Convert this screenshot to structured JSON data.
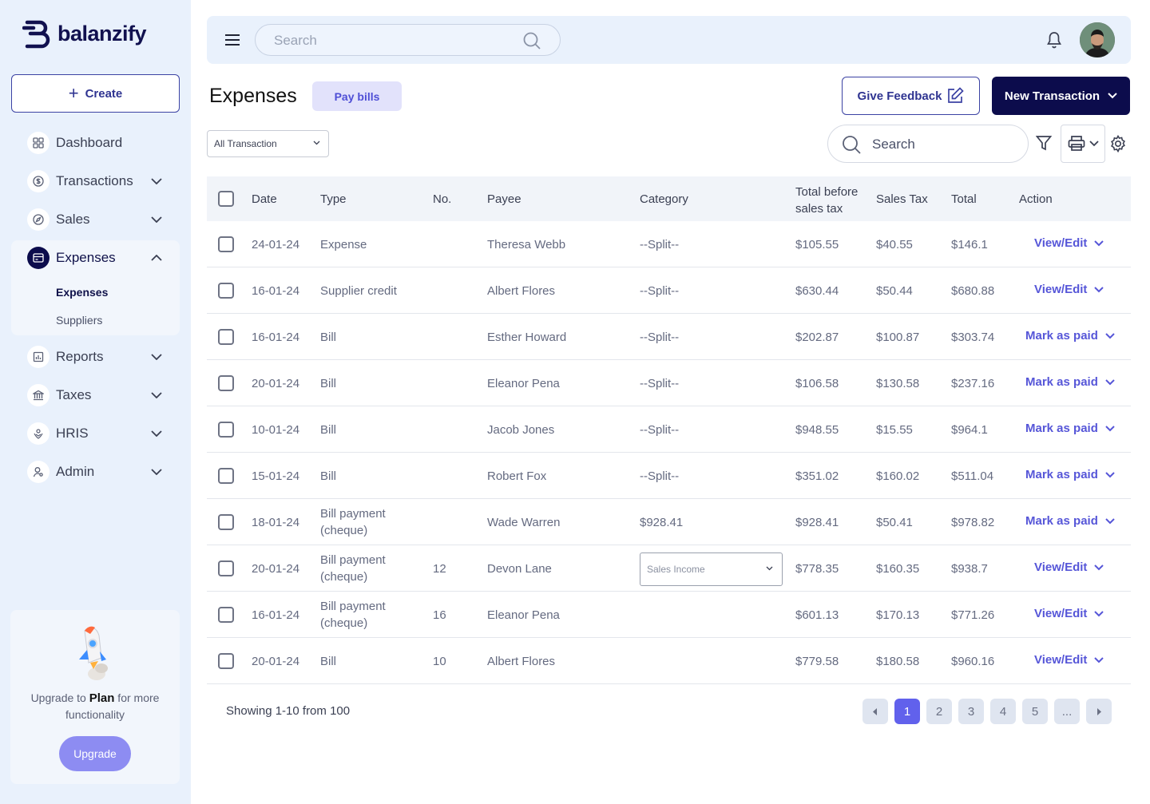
{
  "brand": {
    "name": "balanzify"
  },
  "sidebar": {
    "create_label": "Create",
    "items": [
      {
        "label": "Dashboard",
        "icon": "grid-icon"
      },
      {
        "label": "Transactions",
        "icon": "dollar-coin-icon"
      },
      {
        "label": "Sales",
        "icon": "compass-icon"
      },
      {
        "label": "Expenses",
        "icon": "card-icon"
      },
      {
        "label": "Reports",
        "icon": "chart-icon"
      },
      {
        "label": "Taxes",
        "icon": "bank-icon"
      },
      {
        "label": "HRIS",
        "icon": "hands-icon"
      },
      {
        "label": "Admin",
        "icon": "user-icon"
      }
    ],
    "expenses_sub": [
      "Expenses",
      "Suppliers"
    ],
    "upgrade": {
      "prefix": "Upgrade to ",
      "plan": "Plan",
      "suffix": " for more functionality",
      "button": "Upgrade"
    }
  },
  "topbar": {
    "search_placeholder": "Search"
  },
  "header": {
    "title": "Expenses",
    "pay_bills": "Pay bills",
    "feedback": "Give Feedback",
    "new_transaction": "New Transaction"
  },
  "filters": {
    "transaction_filter": "All Transaction",
    "search_label": "Search"
  },
  "table": {
    "headers": {
      "date": "Date",
      "type": "Type",
      "no": "No.",
      "payee": "Payee",
      "category": "Category",
      "before_tax_1": "Total before",
      "before_tax_2": "sales tax",
      "sales_tax": "Sales Tax",
      "total": "Total",
      "action": "Action"
    },
    "rows": [
      {
        "date": "24-01-24",
        "type": "Expense",
        "type2": "",
        "no": "",
        "payee": "Theresa Webb",
        "category": "--Split--",
        "before": "$105.55",
        "tax": "$40.55",
        "total": "$146.1",
        "action": "View/Edit"
      },
      {
        "date": "16-01-24",
        "type": "Supplier credit",
        "type2": "",
        "no": "",
        "payee": "Albert Flores",
        "category": "--Split--",
        "before": "$630.44",
        "tax": "$50.44",
        "total": "$680.88",
        "action": "View/Edit"
      },
      {
        "date": "16-01-24",
        "type": "Bill",
        "type2": "",
        "no": "",
        "payee": "Esther Howard",
        "category": "--Split--",
        "before": "$202.87",
        "tax": "$100.87",
        "total": "$303.74",
        "action": "Mark as paid"
      },
      {
        "date": "20-01-24",
        "type": "Bill",
        "type2": "",
        "no": "",
        "payee": "Eleanor Pena",
        "category": "--Split--",
        "before": "$106.58",
        "tax": "$130.58",
        "total": "$237.16",
        "action": "Mark as paid"
      },
      {
        "date": "10-01-24",
        "type": "Bill",
        "type2": "",
        "no": "",
        "payee": "Jacob Jones",
        "category": "--Split--",
        "before": "$948.55",
        "tax": "$15.55",
        "total": "$964.1",
        "action": "Mark as paid"
      },
      {
        "date": "15-01-24",
        "type": "Bill",
        "type2": "",
        "no": "",
        "payee": "Robert Fox",
        "category": "--Split--",
        "before": "$351.02",
        "tax": "$160.02",
        "total": "$511.04",
        "action": "Mark as paid"
      },
      {
        "date": "18-01-24",
        "type": "Bill payment",
        "type2": "(cheque)",
        "no": "",
        "payee": "Wade Warren",
        "category": "$928.41",
        "before": "$928.41",
        "tax": "$50.41",
        "total": "$978.82",
        "action": "Mark as paid"
      },
      {
        "date": "20-01-24",
        "type": "Bill payment",
        "type2": "(cheque)",
        "no": "12",
        "payee": "Devon Lane",
        "category": "",
        "category_select": "Sales Income",
        "before": "$778.35",
        "tax": "$160.35",
        "total": "$938.7",
        "action": "View/Edit"
      },
      {
        "date": "16-01-24",
        "type": "Bill payment",
        "type2": "(cheque)",
        "no": "16",
        "payee": "Eleanor Pena",
        "category": "",
        "before": "$601.13",
        "tax": "$170.13",
        "total": "$771.26",
        "action": "View/Edit"
      },
      {
        "date": "20-01-24",
        "type": "Bill",
        "type2": "",
        "no": "10",
        "payee": "Albert Flores",
        "category": "",
        "before": "$779.58",
        "tax": "$180.58",
        "total": "$960.16",
        "action": "View/Edit"
      }
    ]
  },
  "pagination": {
    "showing": "Showing 1-10 from 100",
    "pages": [
      "1",
      "2",
      "3",
      "4",
      "5",
      "..."
    ],
    "current": "1"
  }
}
